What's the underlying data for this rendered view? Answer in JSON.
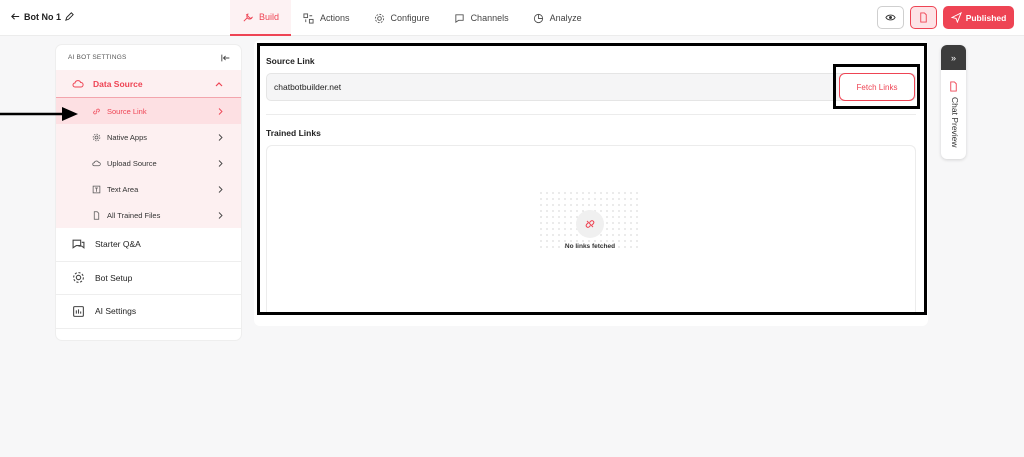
{
  "header": {
    "bot_name": "Bot No 1",
    "tabs": [
      {
        "label": "Build",
        "icon": "wrench-icon"
      },
      {
        "label": "Actions",
        "icon": "actions-icon"
      },
      {
        "label": "Configure",
        "icon": "gear-icon"
      },
      {
        "label": "Channels",
        "icon": "chat-bubble-icon"
      },
      {
        "label": "Analyze",
        "icon": "pie-chart-icon"
      }
    ],
    "active_tab": "Build",
    "publish_label": "Published",
    "accent_color": "#ee4454"
  },
  "sidebar": {
    "title": "AI BOT SETTINGS",
    "data_source_label": "Data Source",
    "sub_items": [
      {
        "label": "Source Link",
        "icon": "link-icon"
      },
      {
        "label": "Native Apps",
        "icon": "gear-icon"
      },
      {
        "label": "Upload Source",
        "icon": "cloud-upload-icon"
      },
      {
        "label": "Text Area",
        "icon": "text-area-icon"
      },
      {
        "label": "All Trained Files",
        "icon": "files-icon"
      }
    ],
    "items": [
      {
        "label": "Starter Q&A",
        "icon": "qa-icon"
      },
      {
        "label": "Bot Setup",
        "icon": "gear-icon"
      },
      {
        "label": "AI Settings",
        "icon": "ai-settings-icon"
      }
    ]
  },
  "main": {
    "source_link_title": "Source Link",
    "source_url": "chatbotbuilder.net",
    "fetch_button": "Fetch Links",
    "trained_links_title": "Trained Links",
    "empty_message": "No links fetched"
  },
  "chat_preview": {
    "label": "Chat Preview"
  }
}
